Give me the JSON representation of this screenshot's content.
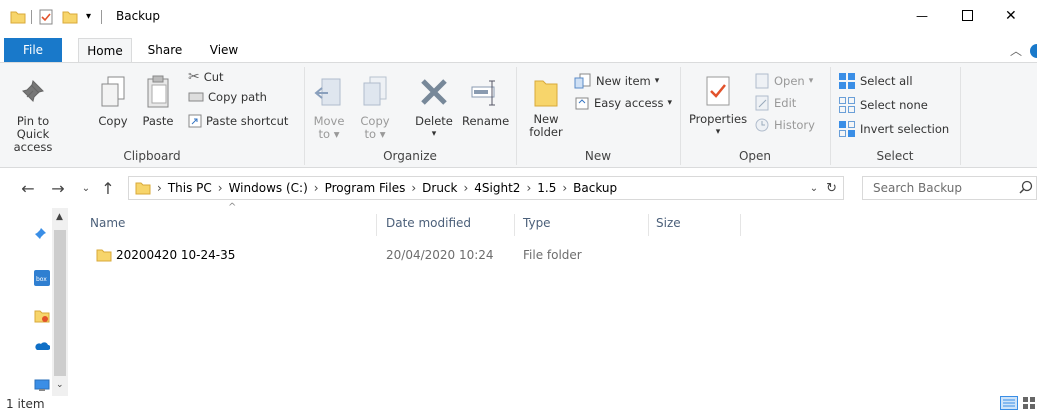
{
  "window": {
    "title": "Backup",
    "minimize_glyph": "—",
    "maximize_glyph": "☐",
    "close_glyph": "✕"
  },
  "tabs": {
    "file": "File",
    "home": "Home",
    "share": "Share",
    "view": "View"
  },
  "ribbon": {
    "clipboard": {
      "label": "Clipboard",
      "pin_line1": "Pin to Quick",
      "pin_line2": "access",
      "copy": "Copy",
      "paste": "Paste",
      "cut": "Cut",
      "copy_path": "Copy path",
      "paste_shortcut": "Paste shortcut"
    },
    "organize": {
      "label": "Organize",
      "move_line1": "Move",
      "move_line2": "to",
      "copy_line1": "Copy",
      "copy_line2": "to",
      "delete": "Delete",
      "rename": "Rename"
    },
    "new": {
      "label": "New",
      "new_folder_line1": "New",
      "new_folder_line2": "folder",
      "new_item": "New item",
      "easy_access": "Easy access"
    },
    "open": {
      "label": "Open",
      "properties": "Properties",
      "open": "Open",
      "edit": "Edit",
      "history": "History"
    },
    "select": {
      "label": "Select",
      "select_all": "Select all",
      "select_none": "Select none",
      "invert_selection": "Invert selection"
    }
  },
  "address": {
    "crumbs": [
      "This PC",
      "Windows (C:)",
      "Program Files",
      "Druck",
      "4Sight2",
      "1.5",
      "Backup"
    ],
    "search_placeholder": "Search Backup"
  },
  "columns": {
    "name": "Name",
    "date_modified": "Date modified",
    "type": "Type",
    "size": "Size"
  },
  "files": [
    {
      "name": "20200420 10-24-35",
      "date_modified": "20/04/2020 10:24",
      "type": "File folder",
      "size": ""
    }
  ],
  "status": {
    "item_count": "1 item"
  },
  "colors": {
    "accent": "#1979ca",
    "folder": "#f7d56b",
    "ribbon_bg": "#f5f6f7",
    "header_text": "#4c607a"
  }
}
